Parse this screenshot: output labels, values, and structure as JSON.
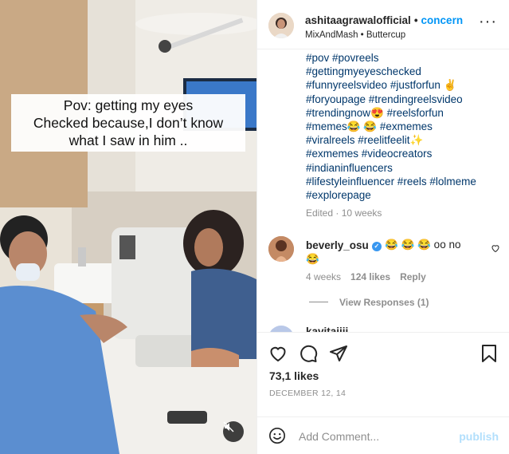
{
  "media": {
    "caption_lines": [
      "Pov: getting my eyes",
      "Checked because,I don’t know",
      "what I saw in him .."
    ]
  },
  "header": {
    "username": "ashitaagrawalofficial",
    "separator": "•",
    "follow_label": "concern",
    "audio": "MixAndMash • Buttercup",
    "more_label": "···"
  },
  "caption": {
    "tag_lines": [
      "#pov #povreels",
      "#gettingmyeyeschecked",
      "#funnyreelsvideo #justforfun ✌️",
      "#foryoupage #trendingreelsvideo",
      "#trendingnow😍 #reelsforfun",
      "#memes😂 😂 #exmemes",
      "#viralreels #reelitfeelit✨",
      "#exmemes #videocreators",
      "#indianinfluencers",
      "#lifestyleinfluencer #reels #lolmeme",
      "#explorepage"
    ],
    "edited": "Edited · 10 weeks"
  },
  "comment": {
    "username": "beverly_osu",
    "text": "😂 😂 😂 oo no",
    "text_line2": "😂",
    "time": "4 weeks",
    "likes": "124 likes",
    "reply": "Reply",
    "view_responses": "View Responses (1)",
    "next_username": "kavitajiji"
  },
  "actions": {
    "likes": "73,1 likes",
    "date": "DECEMBER 12, 14"
  },
  "add_comment": {
    "placeholder": "Add Comment...",
    "publish": "publish"
  },
  "colors": {
    "link": "#00376b",
    "accent": "#0095f6",
    "muted": "#8e8e8e",
    "publish_disabled": "#b2dffc"
  }
}
